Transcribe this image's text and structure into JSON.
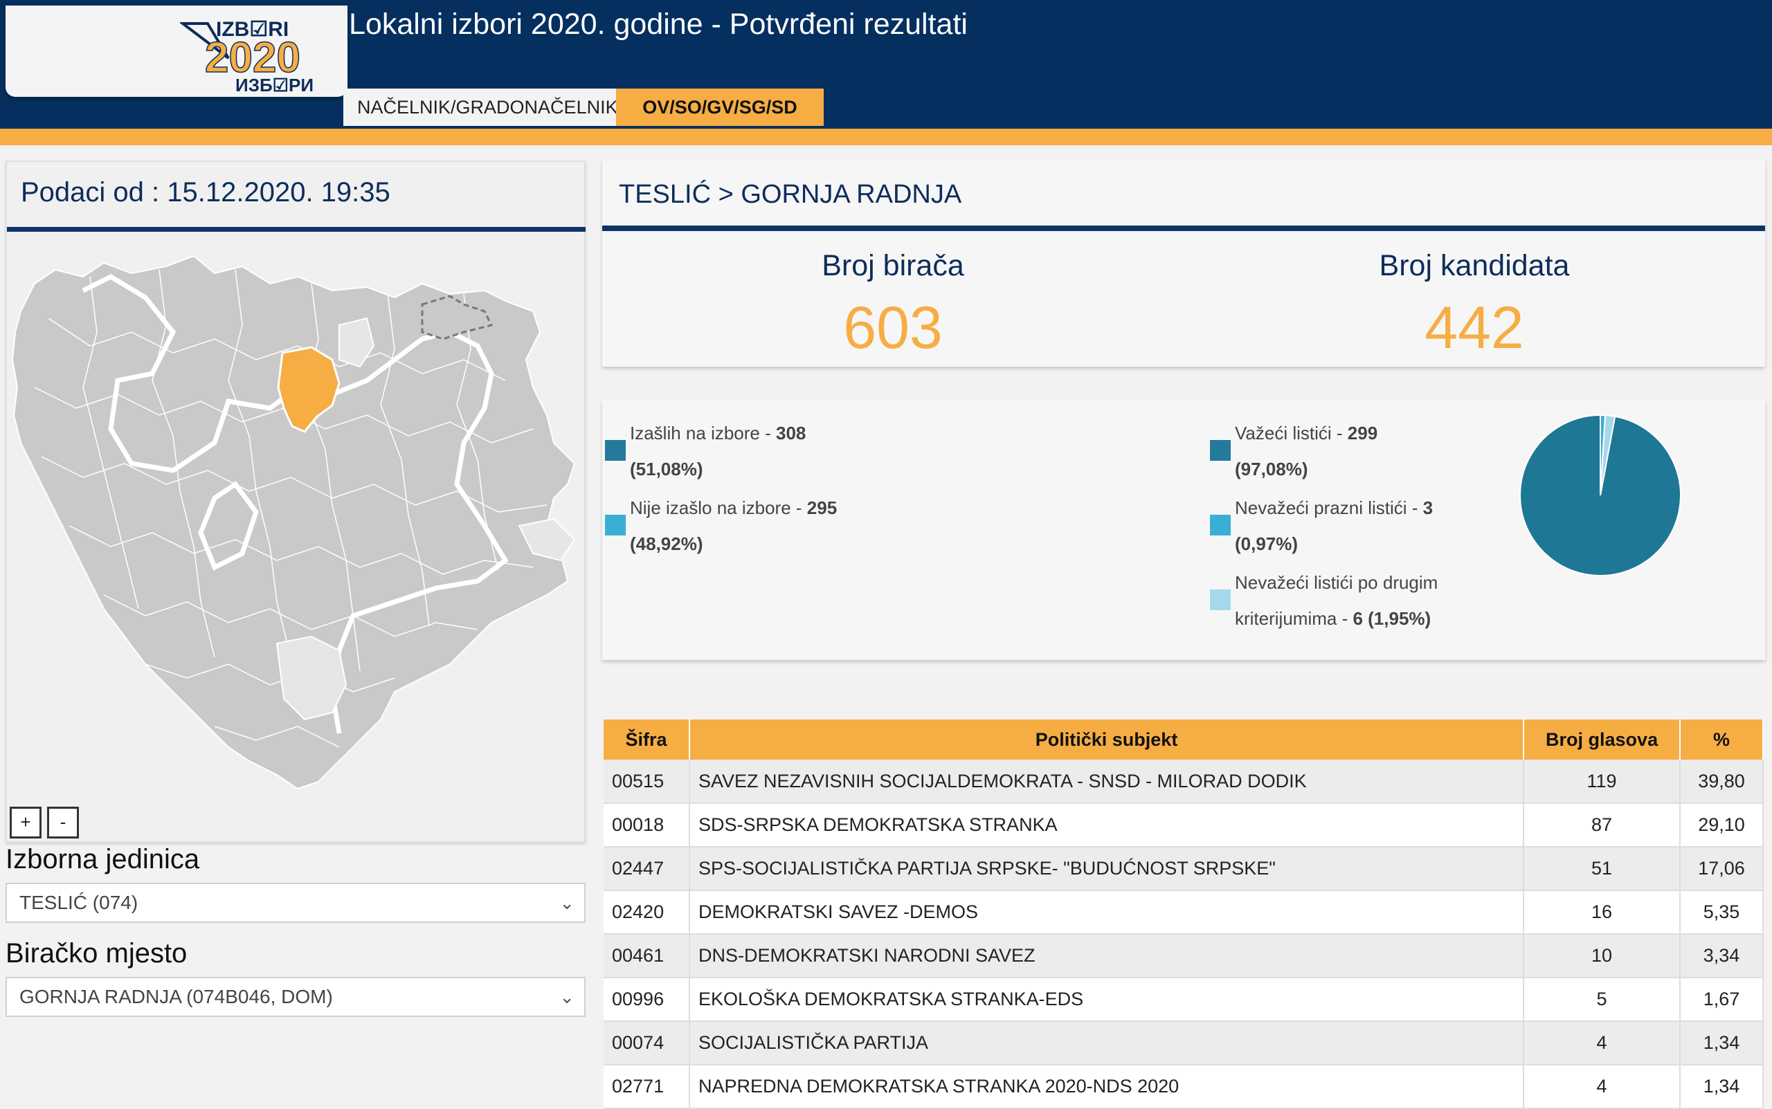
{
  "header": {
    "title": "Lokalni izbori 2020. godine - Potvrđeni rezultati",
    "logo": {
      "top": "IZB☑RI",
      "year": "2020",
      "bottom": "ИЗБ☑РИ"
    },
    "tabs": [
      {
        "label": "NAČELNIK/GRADONAČELNIK",
        "active": false
      },
      {
        "label": "OV/SO/GV/SG/SD",
        "active": true
      }
    ]
  },
  "sidebar": {
    "data_date": "Podaci od : 15.12.2020. 19:35",
    "zoom_in": "+",
    "zoom_out": "-",
    "unit_label": "Izborna jedinica",
    "unit_value": "TESLIĆ (074)",
    "place_label": "Biračko mjesto",
    "place_value": "GORNJA RADNJA (074B046, DOM)"
  },
  "location": {
    "breadcrumb": "TESLIĆ > GORNJA RADNJA",
    "voters_label": "Broj birača",
    "voters_value": "603",
    "candidates_label": "Broj kandidata",
    "candidates_value": "442"
  },
  "turnout": {
    "voted_label": "Izašlih na izbore - ",
    "voted_value": "308",
    "voted_pct": "(51,08%)",
    "not_voted_label": "Nije izašlo na izbore - ",
    "not_voted_value": "295",
    "not_voted_pct": "(48,92%)",
    "valid_label": "Važeći listići - ",
    "valid_value": "299",
    "valid_pct": "(97,08%)",
    "empty_label": "Nevažeći prazni listići - ",
    "empty_value": "3",
    "empty_pct": "(0,97%)",
    "other_label_1": "Nevažeći listići po drugim",
    "other_label_2": "kriterijumima - ",
    "other_value": "6 (1,95%)"
  },
  "colors": {
    "navy": "#052f5f",
    "orange": "#f6ad44",
    "teal_dark": "#247a9a",
    "teal": "#3aafd4",
    "teal_light": "#a5d8ea",
    "pie_main": "#1e7895"
  },
  "chart_data": {
    "type": "pie",
    "categories": [
      "Važeći listići",
      "Nevažeći prazni listići",
      "Nevažeći listići po drugim kriterijumima"
    ],
    "values": [
      299,
      3,
      6
    ]
  },
  "table": {
    "headers": [
      "Šifra",
      "Politički subjekt",
      "Broj glasova",
      "%"
    ],
    "rows": [
      [
        "00515",
        "SAVEZ NEZAVISNIH SOCIJALDEMOKRATA - SNSD - MILORAD DODIK",
        "119",
        "39,80"
      ],
      [
        "00018",
        "SDS-SRPSKA DEMOKRATSKA STRANKA",
        "87",
        "29,10"
      ],
      [
        "02447",
        "SPS-SOCIJALISTIČKA PARTIJA SRPSKE- \"BUDUĆNOST SRPSKE\"",
        "51",
        "17,06"
      ],
      [
        "02420",
        "DEMOKRATSKI SAVEZ -DEMOS",
        "16",
        "5,35"
      ],
      [
        "00461",
        "DNS-DEMOKRATSKI NARODNI SAVEZ",
        "10",
        "3,34"
      ],
      [
        "00996",
        "EKOLOŠKA DEMOKRATSKA STRANKA-EDS",
        "5",
        "1,67"
      ],
      [
        "00074",
        "SOCIJALISTIČKA PARTIJA",
        "4",
        "1,34"
      ],
      [
        "02771",
        "NAPREDNA DEMOKRATSKA STRANKA 2020-NDS 2020",
        "4",
        "1,34"
      ]
    ]
  }
}
